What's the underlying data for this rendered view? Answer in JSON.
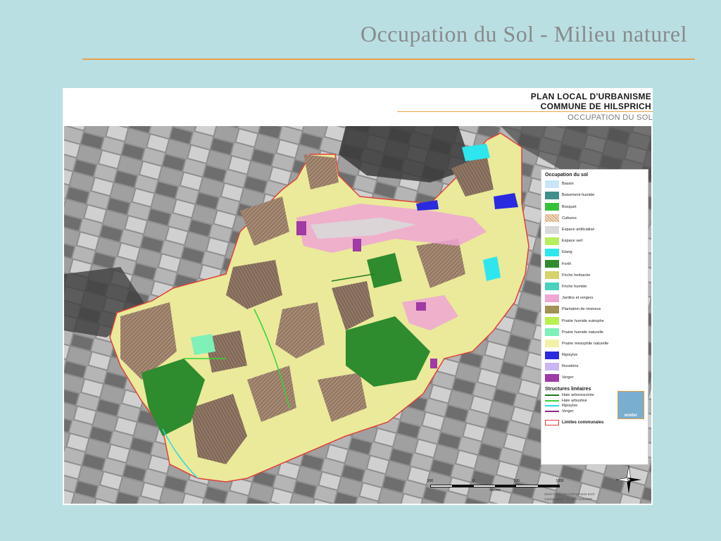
{
  "slide": {
    "title": "Occupation du Sol - Milieu naturel"
  },
  "map": {
    "header": {
      "line1": "PLAN LOCAL D'URBANISME",
      "line2": "COMMUNE DE HILSPRICH",
      "line3": "OCCUPATION DU SOL"
    },
    "legend": {
      "title": "Occupation du sol",
      "items": [
        {
          "label": "Bassin",
          "color": "#c8e6f5"
        },
        {
          "label": "Boisement humide",
          "color": "#3f8f8b"
        },
        {
          "label": "Bosquet",
          "color": "#35c23a"
        },
        {
          "label": "Cultures",
          "color": "#d9b48f"
        },
        {
          "label": "Espace artificialisé",
          "color": "#d9d9d9"
        },
        {
          "label": "Espace vert",
          "color": "#b8ee5b"
        },
        {
          "label": "Etang",
          "color": "#2ee6ee"
        },
        {
          "label": "Forêt",
          "color": "#2e8b2e"
        },
        {
          "label": "Friche herbacée",
          "color": "#d5d36a"
        },
        {
          "label": "Friche humide",
          "color": "#48d2be"
        },
        {
          "label": "Jardins et vergers",
          "color": "#f0a6d3"
        },
        {
          "label": "Plantation de résineux",
          "color": "#a39256"
        },
        {
          "label": "Prairie humide eutrophe",
          "color": "#b9f24f"
        },
        {
          "label": "Prairie humide naturelle",
          "color": "#7ef0b8"
        },
        {
          "label": "Prairie mésophile naturelle",
          "color": "#f3f2a4"
        },
        {
          "label": "Ripisylve",
          "color": "#2a2ae0"
        },
        {
          "label": "Roselière",
          "color": "#c9b6f2"
        },
        {
          "label": "Verger",
          "color": "#a03aa6"
        }
      ],
      "lines_title": "Structures linéaires",
      "lines": [
        {
          "label": "Haie arborescente",
          "color": "#1e7a1e"
        },
        {
          "label": "Haie arbustive",
          "color": "#36d336"
        },
        {
          "label": "Ripisylve",
          "color": "#2ed6e6"
        },
        {
          "label": "Verger",
          "color": "#8a2a8a"
        }
      ],
      "limit_label": "Limites communales",
      "limit_color": "#e0403a"
    },
    "credit": {
      "line1": "2018 Fond IGN Orthophotos 5m©",
      "line2": "Cartographie : S. LETHUILLIER"
    },
    "logo_text": "ecolor",
    "scale": {
      "labels": [
        "500",
        "0",
        "500",
        "1000"
      ],
      "unit": "Metres"
    },
    "north": "N"
  }
}
